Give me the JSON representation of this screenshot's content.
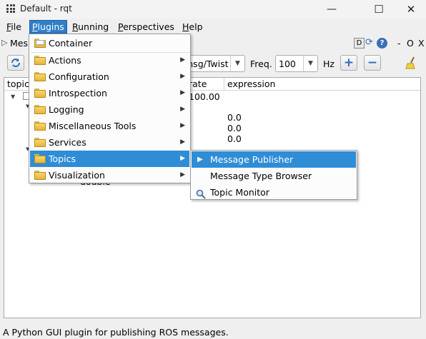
{
  "window": {
    "title": "Default - rqt",
    "minimize": "—",
    "maximize": "☐",
    "close": "✕"
  },
  "menubar": [
    {
      "label": "File",
      "ul": "F",
      "rest": "ile"
    },
    {
      "label": "Plugins",
      "ul": "P",
      "rest": "lugins"
    },
    {
      "label": "Running",
      "ul": "R",
      "rest": "unning"
    },
    {
      "label": "Perspectives",
      "ul": "P",
      "rest": "erspectives"
    },
    {
      "label": "Help",
      "ul": "H",
      "rest": "elp"
    }
  ],
  "plugin": {
    "title_visible": "Mes",
    "d_button": "D",
    "help_icon": "?",
    "dash": "-",
    "o_label": "O",
    "x_label": "X"
  },
  "toolbar": {
    "type_value": "msg/Twist",
    "freq_label": "Freq.",
    "freq_value": "100",
    "hz_label": "Hz",
    "add_label": "+",
    "remove_label": "−"
  },
  "tree": {
    "columns": [
      "topic",
      "rate",
      "expression"
    ],
    "rows": [
      {
        "rate": "100.00",
        "expression": ""
      },
      {
        "rate": "",
        "expression": "0.0"
      },
      {
        "rate": "",
        "expression": "0.0"
      },
      {
        "rate": "",
        "expression": "0.0"
      }
    ],
    "partial_text": "double"
  },
  "plugins_menu": {
    "items": [
      {
        "label": "Container",
        "submenu": false
      },
      {
        "label": "Actions",
        "submenu": true
      },
      {
        "label": "Configuration",
        "submenu": true
      },
      {
        "label": "Introspection",
        "submenu": true
      },
      {
        "label": "Logging",
        "submenu": true
      },
      {
        "label": "Miscellaneous Tools",
        "submenu": true
      },
      {
        "label": "Services",
        "submenu": true
      },
      {
        "label": "Topics",
        "submenu": true,
        "highlighted": true
      },
      {
        "label": "Visualization",
        "submenu": true
      }
    ]
  },
  "topics_submenu": {
    "items": [
      {
        "label": "Message Publisher",
        "icon": "play-icon",
        "highlighted": true
      },
      {
        "label": "Message Type Browser",
        "icon": ""
      },
      {
        "label": "Topic Monitor",
        "icon": "magnifier-icon"
      }
    ]
  },
  "status": {
    "text": "A Python GUI plugin for publishing ROS messages."
  },
  "colors": {
    "highlight": "#2f8dd6",
    "menu_active": "#2f7fc9"
  }
}
